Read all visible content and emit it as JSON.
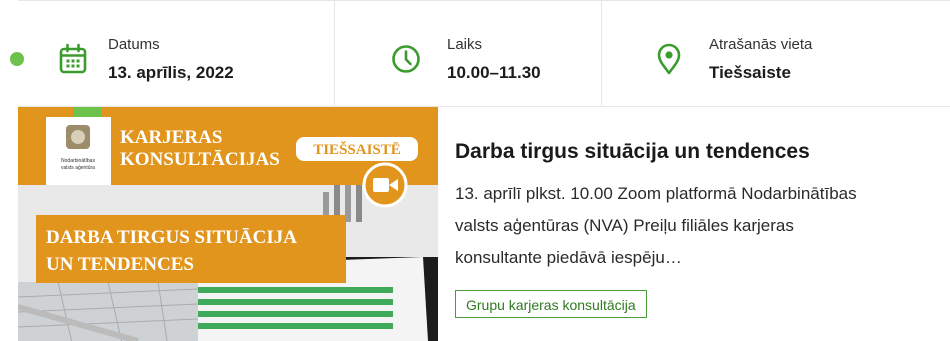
{
  "colors": {
    "accent_green": "#3b9c2e",
    "banner_orange": "#e1951d",
    "dot_green": "#6cc24a"
  },
  "event_info": {
    "date": {
      "label": "Datums",
      "value": "13. aprīlis, 2022",
      "icon": "calendar-icon"
    },
    "time": {
      "label": "Laiks",
      "value": "10.00–11.30",
      "icon": "clock-icon"
    },
    "location": {
      "label": "Atrašanās vieta",
      "value": "Tiešsaiste",
      "icon": "location-pin-icon"
    }
  },
  "banner": {
    "logo_text_line1": "Nodarbinātības",
    "logo_text_line2": "valsts aģentūra",
    "heading_line1": "KARJERAS",
    "heading_line2": "KONSULTĀCIJAS",
    "online_badge": "TIEŠSAISTĒ",
    "topic_line1": "DARBA TIRGUS SITUĀCIJA",
    "topic_line2": "UN TENDENCES",
    "video_icon": "video-camera-icon"
  },
  "article": {
    "title": "Darba tirgus situācija un tendences",
    "desc_lines": [
      "13. aprīlī plkst. 10.00 Zoom platformā Nodarbinātības",
      "valsts aģentūras (NVA) Preiļu filiāles karjeras",
      "konsultante piedāvā iespēju…"
    ],
    "tag": "Grupu karjeras konsultācija"
  }
}
